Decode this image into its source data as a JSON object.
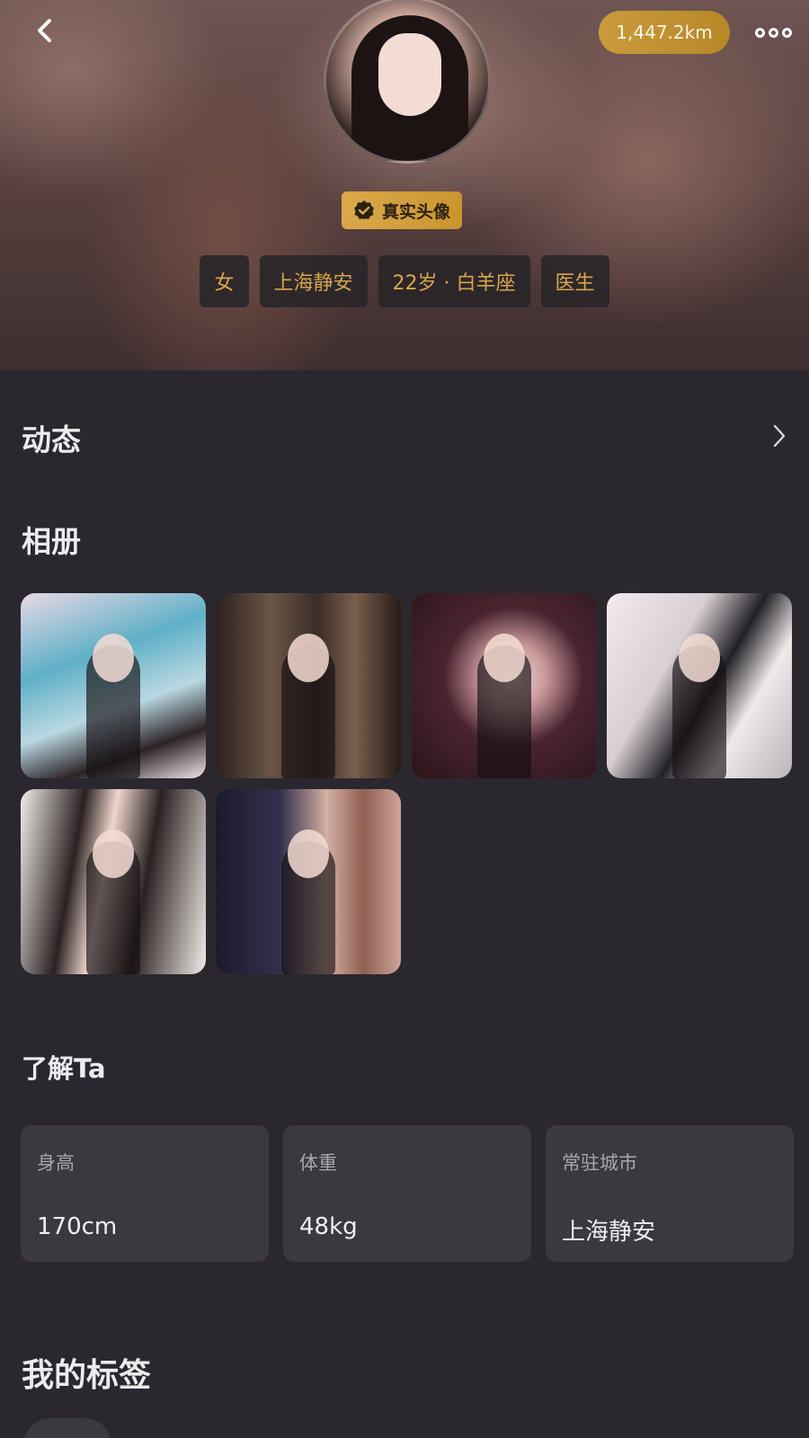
{
  "header": {
    "distance": "1,447.2km",
    "verified_label": "真实头像",
    "tags": [
      "女",
      "上海静安",
      "22岁 · 白羊座",
      "医生"
    ]
  },
  "sections": {
    "moments_title": "动态",
    "album_title": "相册",
    "about_title": "了解Ta",
    "tags_title": "我的标签"
  },
  "stats": [
    {
      "label": "身高",
      "value": "170cm"
    },
    {
      "label": "体重",
      "value": "48kg"
    },
    {
      "label": "常驻城市",
      "value": "上海静安"
    }
  ],
  "colors": {
    "accent_gold": "#c99b3d",
    "tag_text": "#d7a54c",
    "background": "#2a282e",
    "card": "#3a393e"
  },
  "icons": {
    "back": "back-arrow-icon",
    "more": "more-dots-icon",
    "verified": "verified-badge-icon",
    "chevron": "chevron-right-icon"
  }
}
